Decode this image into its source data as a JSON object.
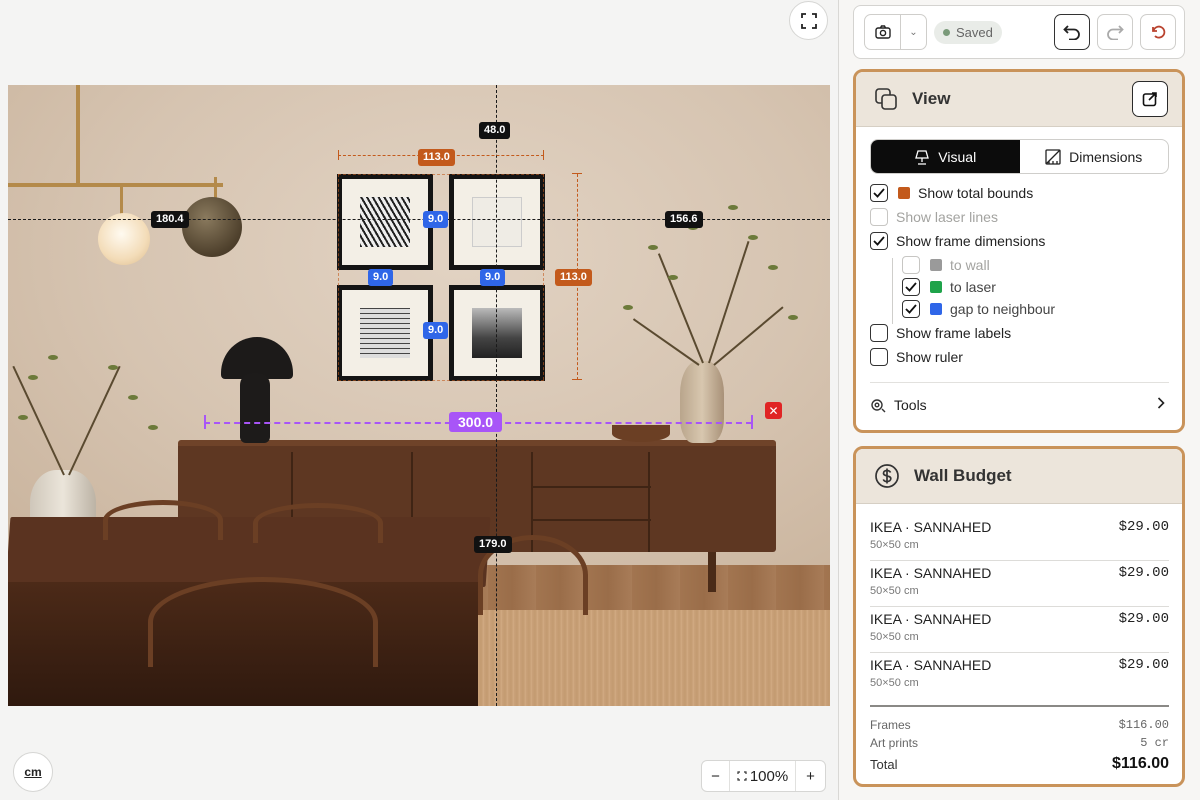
{
  "canvas": {
    "measurements": {
      "top_gap": "48.0",
      "group_width": "113.0",
      "group_height": "113.0",
      "left_gap": "180.4",
      "right_gap": "156.6",
      "bottom_gap": "179.0",
      "gap_h_top": "9.0",
      "gap_h_bottom": "9.0",
      "gap_v_left": "9.0",
      "gap_v_right": "9.0",
      "laser_width": "300.0"
    },
    "laser_close_glyph": "✕",
    "unit_label": "cm",
    "zoom": {
      "out": "−",
      "level": "100%",
      "in": "+"
    }
  },
  "toolbar": {
    "saved_label": "Saved",
    "dropdown_glyph": "⌄"
  },
  "view": {
    "title": "View",
    "tabs": [
      {
        "label": "Visual",
        "active": true
      },
      {
        "label": "Dimensions",
        "active": false
      }
    ],
    "options": [
      {
        "label": "Show total bounds",
        "checked": true,
        "swatch": "#c35a1c",
        "disabled": false
      },
      {
        "label": "Show laser lines",
        "checked": false,
        "disabled": true
      },
      {
        "label": "Show frame dimensions",
        "checked": true,
        "disabled": false
      },
      {
        "label": "to wall",
        "checked": false,
        "swatch": "#9a9a9a",
        "disabled": true
      },
      {
        "label": "to laser",
        "checked": true,
        "swatch": "#1fa34a",
        "disabled": false
      },
      {
        "label": "gap to neighbour",
        "checked": true,
        "swatch": "#2f66e8",
        "disabled": false
      },
      {
        "label": "Show frame labels",
        "checked": false,
        "disabled": false
      },
      {
        "label": "Show ruler",
        "checked": false,
        "disabled": false
      }
    ],
    "tools_label": "Tools"
  },
  "budget": {
    "title": "Wall Budget",
    "items": [
      {
        "name": "IKEA · SANNAHED",
        "size": "50×50 cm",
        "price": "$29.00"
      },
      {
        "name": "IKEA · SANNAHED",
        "size": "50×50 cm",
        "price": "$29.00"
      },
      {
        "name": "IKEA · SANNAHED",
        "size": "50×50 cm",
        "price": "$29.00"
      },
      {
        "name": "IKEA · SANNAHED",
        "size": "50×50 cm",
        "price": "$29.00"
      }
    ],
    "summary": {
      "frames_label": "Frames",
      "frames_value": "$116.00",
      "prints_label": "Art prints",
      "prints_value": "5 cr",
      "total_label": "Total",
      "total_value": "$116.00"
    }
  },
  "colors": {
    "accent_border": "#c9935a",
    "bounds_orange": "#c35a1c",
    "gap_blue": "#2f66e8",
    "laser_purple": "#a855f7",
    "laser_green": "#1fa34a"
  }
}
